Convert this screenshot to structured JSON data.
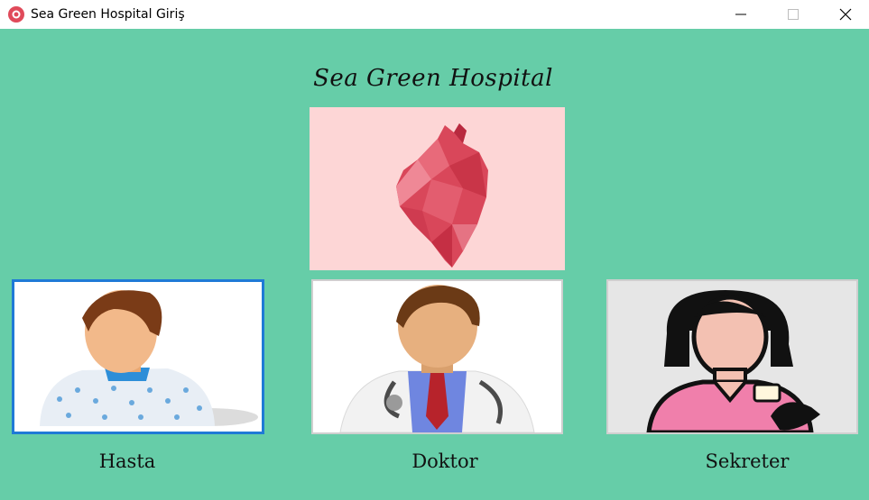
{
  "window": {
    "title": "Sea Green Hospital Giriş",
    "icon": "app-logo-icon",
    "controls": [
      "minimize-icon",
      "maximize-icon",
      "close-icon"
    ]
  },
  "main": {
    "heading": "Sea Green Hospital",
    "hero_image": "heart-illustration",
    "roles": [
      {
        "label": "Hasta",
        "icon": "patient-avatar-icon",
        "selected": true
      },
      {
        "label": "Doktor",
        "icon": "doctor-avatar-icon",
        "selected": false
      },
      {
        "label": "Sekreter",
        "icon": "secretary-avatar-icon",
        "selected": false
      }
    ]
  },
  "colors": {
    "background": "#66cda8",
    "hero_background": "#fdd6d6",
    "selection_border": "#1f7ad6"
  }
}
